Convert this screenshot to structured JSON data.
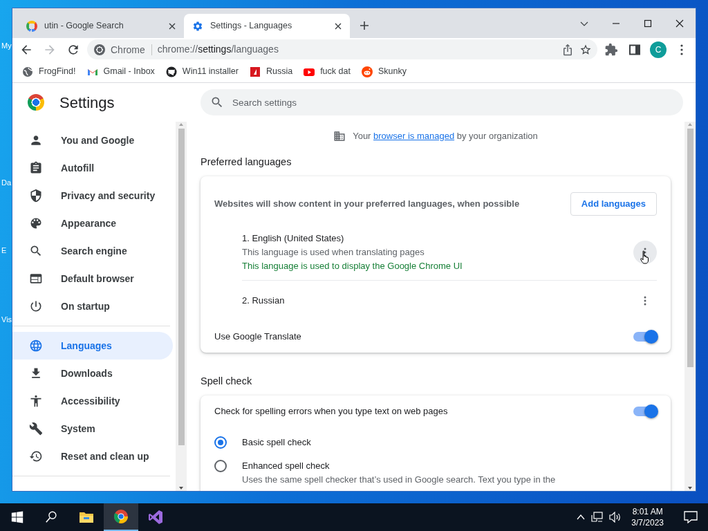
{
  "desktop_icons": [
    {
      "label": "My"
    },
    {
      "label": "Da"
    },
    {
      "label": "E"
    },
    {
      "label": "Vis"
    }
  ],
  "browser": {
    "tabs": [
      {
        "title": "utin - Google Search",
        "kind": "google",
        "selected": false
      },
      {
        "title": "Settings - Languages",
        "kind": "gear",
        "selected": true
      }
    ],
    "omnibox": {
      "chip": "Chrome",
      "url": {
        "scheme": "chrome://",
        "host": "settings",
        "path": "/languages"
      }
    },
    "profile_initial": "C",
    "bookmarks": [
      {
        "label": "FrogFind!",
        "kind": "globe"
      },
      {
        "label": "Gmail - Inbox",
        "kind": "gmail"
      },
      {
        "label": "Win11 installer",
        "kind": "github"
      },
      {
        "label": "Russia",
        "kind": "redflag"
      },
      {
        "label": "fuck dat",
        "kind": "youtube"
      },
      {
        "label": "Skunky",
        "kind": "reddit"
      }
    ]
  },
  "settings": {
    "title": "Settings",
    "search_placeholder": "Search settings",
    "nav": [
      {
        "label": "You and Google",
        "kind": "person",
        "selected": false
      },
      {
        "label": "Autofill",
        "kind": "clipboard",
        "selected": false
      },
      {
        "label": "Privacy and security",
        "kind": "shield",
        "selected": false
      },
      {
        "label": "Appearance",
        "kind": "palette",
        "selected": false
      },
      {
        "label": "Search engine",
        "kind": "search",
        "selected": false
      },
      {
        "label": "Default browser",
        "kind": "browser",
        "selected": false
      },
      {
        "label": "On startup",
        "kind": "power",
        "selected": false,
        "divider_after": true
      },
      {
        "label": "Languages",
        "kind": "globe",
        "selected": true
      },
      {
        "label": "Downloads",
        "kind": "download",
        "selected": false
      },
      {
        "label": "Accessibility",
        "kind": "accessibility",
        "selected": false
      },
      {
        "label": "System",
        "kind": "wrench",
        "selected": false
      },
      {
        "label": "Reset and clean up",
        "kind": "history",
        "selected": false,
        "divider_after": true
      }
    ],
    "managed_notice": {
      "before": "Your",
      "link": "browser is managed",
      "after": "by your organization"
    },
    "preferred_languages": {
      "title": "Preferred languages",
      "description": "Websites will show content in your preferred languages, when possible",
      "add_button": "Add languages",
      "languages": [
        {
          "name": "1. English (United States)",
          "hovered": true,
          "notes": [
            {
              "text": "This language is used when translating pages",
              "kind": "info"
            },
            {
              "text": "This language is used to display the Google Chrome UI",
              "kind": "ui"
            }
          ]
        },
        {
          "name": "2. Russian",
          "hovered": false
        }
      ],
      "translate": {
        "label": "Use Google Translate",
        "on": true
      }
    },
    "spell_check": {
      "title": "Spell check",
      "toggle": {
        "label": "Check for spelling errors when you type text on web pages",
        "on": true
      },
      "options": [
        {
          "label": "Basic spell check",
          "selected": true
        },
        {
          "label": "Enhanced spell check",
          "selected": false,
          "description": "Uses the same spell checker that’s used in Google search. Text you type in the"
        }
      ]
    }
  },
  "taskbar": {
    "apps": [
      {
        "kind": "explorer",
        "active": false
      },
      {
        "kind": "chrome",
        "active": true
      },
      {
        "kind": "vs",
        "active": false
      }
    ],
    "time": "8:01 AM",
    "date": "3/7/2023"
  }
}
